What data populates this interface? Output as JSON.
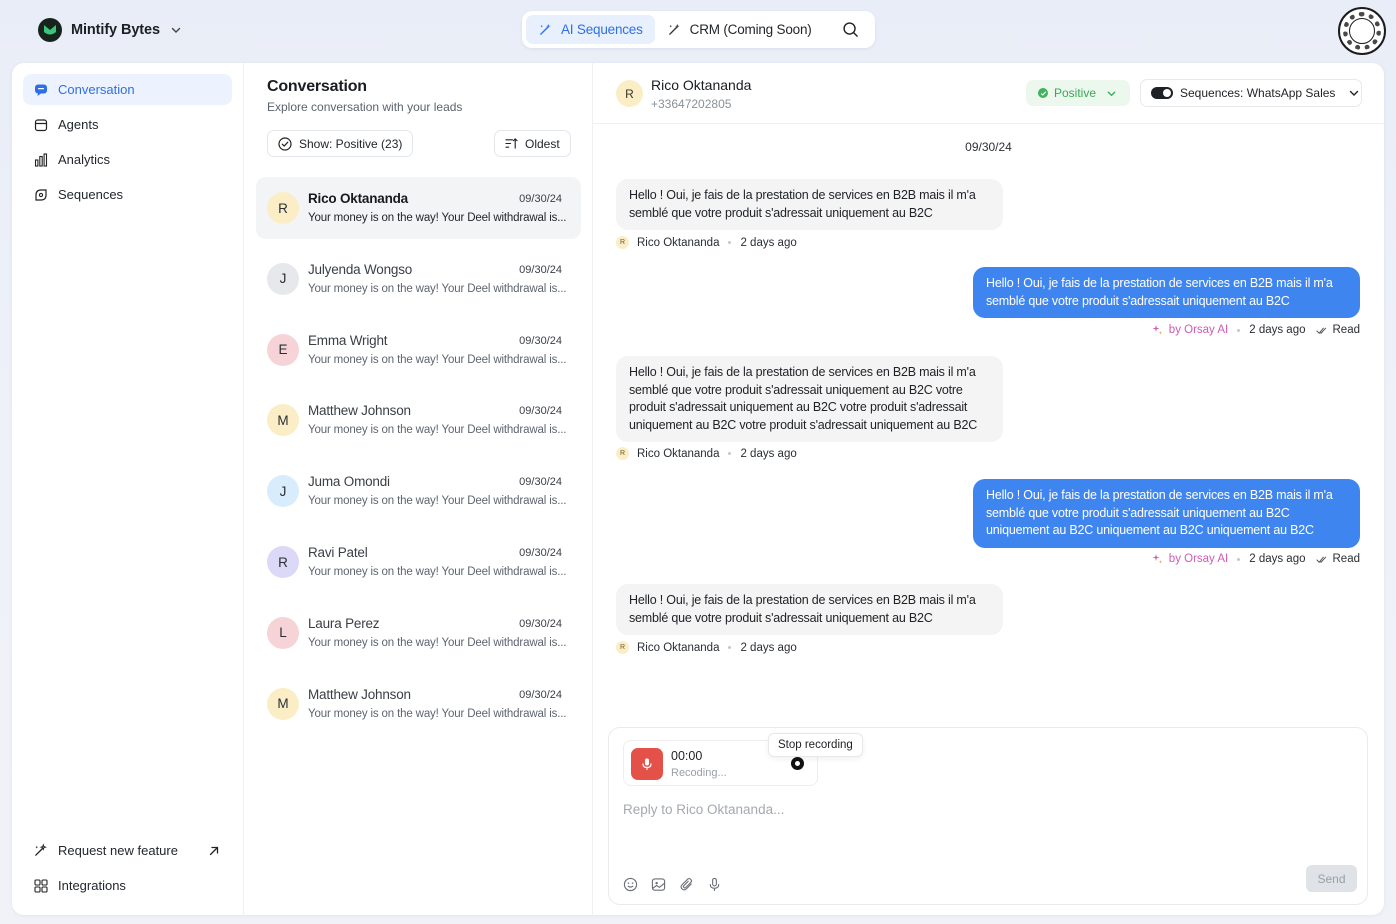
{
  "workspace": {
    "name": "Mintify Bytes"
  },
  "topnav": {
    "tabs": [
      {
        "label": "AI Sequences",
        "active": true,
        "icon": "sparkle-wand-icon"
      },
      {
        "label": "CRM (Coming Soon)",
        "active": false,
        "icon": "sparkle-wand-icon"
      }
    ]
  },
  "sidebar": {
    "items": [
      {
        "label": "Conversation",
        "icon": "chat-icon",
        "active": true
      },
      {
        "label": "Agents",
        "icon": "agent-icon",
        "active": false
      },
      {
        "label": "Analytics",
        "icon": "bar-chart-icon",
        "active": false
      },
      {
        "label": "Sequences",
        "icon": "sequence-icon",
        "active": false
      }
    ],
    "bottom": [
      {
        "label": "Request new feature",
        "icon": "sparkle-wand-icon"
      },
      {
        "label": "Integrations",
        "icon": "grid-icon"
      }
    ]
  },
  "list": {
    "title": "Conversation",
    "subtitle": "Explore conversation with your leads",
    "filter_label": "Show: Positive (23)",
    "sort_label": "Oldest",
    "conversations": [
      {
        "initial": "R",
        "name": "Rico Oktananda",
        "date": "09/30/24",
        "preview": "Your money is on the way! Your Deel withdrawal is...",
        "color": "#fbeec6",
        "active": true
      },
      {
        "initial": "J",
        "name": "Julyenda Wongso",
        "date": "09/30/24",
        "preview": "Your money is on the way! Your Deel withdrawal is...",
        "color": "#e6e8ec",
        "active": false
      },
      {
        "initial": "E",
        "name": "Emma Wright",
        "date": "09/30/24",
        "preview": "Your money is on the way! Your Deel withdrawal is...",
        "color": "#f6d3d6",
        "active": false
      },
      {
        "initial": "M",
        "name": "Matthew Johnson",
        "date": "09/30/24",
        "preview": "Your money is on the way! Your Deel withdrawal is...",
        "color": "#fbeec6",
        "active": false
      },
      {
        "initial": "J",
        "name": "Juma Omondi",
        "date": "09/30/24",
        "preview": "Your money is on the way! Your Deel withdrawal is...",
        "color": "#d9ecfb",
        "active": false
      },
      {
        "initial": "R",
        "name": "Ravi Patel",
        "date": "09/30/24",
        "preview": "Your money is on the way! Your Deel withdrawal is...",
        "color": "#dcd8f7",
        "active": false
      },
      {
        "initial": "L",
        "name": "Laura Perez",
        "date": "09/30/24",
        "preview": "Your money is on the way! Your Deel withdrawal is...",
        "color": "#f6d3d6",
        "active": false
      },
      {
        "initial": "M",
        "name": "Matthew Johnson",
        "date": "09/30/24",
        "preview": "Your money is on the way! Your Deel withdrawal is...",
        "color": "#fbeec6",
        "active": false
      }
    ]
  },
  "chat": {
    "contact_initial": "R",
    "contact_name": "Rico Oktananda",
    "contact_phone": "+33647202805",
    "status": "Positive",
    "sequence": "Sequences: WhatsApp Sales",
    "date": "09/30/24",
    "messages": [
      {
        "dir": "in",
        "text": "Hello ! Oui, je fais de la prestation de services en B2B mais il m'a semblé que votre produit s'adressait uniquement au B2C",
        "sender_initial": "R",
        "sender": "Rico Oktananda",
        "time": "2 days ago"
      },
      {
        "dir": "out",
        "text": "Hello ! Oui, je fais de la prestation de services en B2B mais il m'a semblé que votre produit s'adressait uniquement au B2C",
        "by": "by Orsay AI",
        "time": "2 days ago",
        "read": "Read"
      },
      {
        "dir": "in",
        "text": "Hello ! Oui, je fais de la prestation de services en B2B mais il m'a semblé que votre produit s'adressait uniquement au B2C votre produit s'adressait uniquement au B2C votre produit s'adressait uniquement au B2C votre produit s'adressait uniquement au B2C",
        "sender_initial": "R",
        "sender": "Rico Oktananda",
        "time": "2 days ago"
      },
      {
        "dir": "out",
        "text": "Hello ! Oui, je fais de la prestation de services en B2B mais il m'a semblé que votre produit s'adressait uniquement au B2C uniquement au B2C uniquement au B2C uniquement au B2C",
        "by": "by Orsay AI",
        "time": "2 days ago",
        "read": "Read"
      },
      {
        "dir": "in",
        "text": "Hello ! Oui, je fais de la prestation de services en B2B mais il m'a semblé que votre produit s'adressait uniquement au B2C",
        "sender_initial": "R",
        "sender": "Rico Oktananda",
        "time": "2 days ago"
      }
    ],
    "composer": {
      "timer": "00:00",
      "recording_status": "Recoding...",
      "tooltip": "Stop recording",
      "placeholder": "Reply to Rico Oktananda...",
      "send_label": "Send"
    }
  },
  "colors": {
    "accent": "#2f6fe3",
    "outgoing_bubble": "#3f85f0",
    "positive": "#3fb25d",
    "record": "#e45148"
  }
}
